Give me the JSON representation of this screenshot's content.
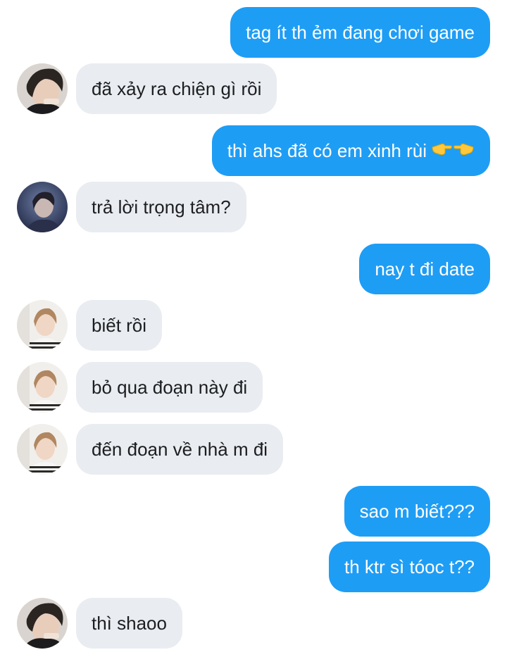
{
  "messages": [
    {
      "side": "out",
      "text": "tag ít th ẻm đang chơi game"
    },
    {
      "side": "in",
      "avatar": "avatar-dark-hair",
      "text": "đã xảy ra chiện gì rồi"
    },
    {
      "side": "out",
      "text": "thì ahs đã có em xinh rùi",
      "emoji": "pointing-hands-emoji"
    },
    {
      "side": "in",
      "avatar": "avatar-blue-tone",
      "text": "trả lời trọng tâm?"
    },
    {
      "side": "out",
      "text": "nay t đi date"
    },
    {
      "side": "in",
      "avatar": "avatar-light-hair",
      "text": "biết rồi"
    },
    {
      "side": "in",
      "avatar": "avatar-light-hair",
      "text": "bỏ qua đoạn này đi"
    },
    {
      "side": "in",
      "avatar": "avatar-light-hair",
      "text": "đến đoạn về nhà m đi"
    },
    {
      "side": "out",
      "text": "sao m biết???"
    },
    {
      "side": "out",
      "text": "th ktr sì tóoc t??"
    },
    {
      "side": "in",
      "avatar": "avatar-dark-hair",
      "text": "thì shaoo"
    }
  ],
  "colors": {
    "outgoing_bubble": "#1e9df5",
    "incoming_bubble": "#e9ecf0"
  }
}
